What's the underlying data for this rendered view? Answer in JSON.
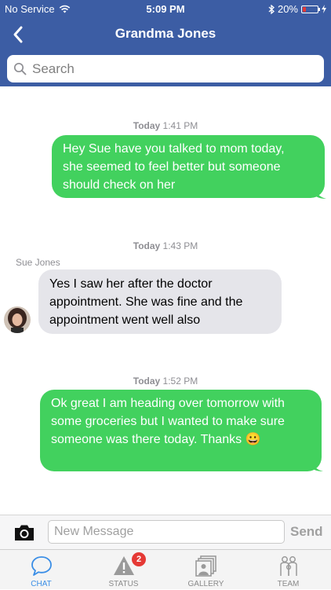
{
  "status_bar": {
    "carrier": "No Service",
    "time": "5:09 PM",
    "battery_percent": "20%",
    "battery_level": 0.2
  },
  "nav": {
    "title": "Grandma Jones"
  },
  "search": {
    "placeholder": "Search"
  },
  "messages": [
    {
      "day": "Today",
      "time": "1:41 PM",
      "direction": "outgoing",
      "lines": [
        "Hey Sue have you talked to mom today,",
        "she seemed to feel better but someone",
        "should check on her"
      ]
    },
    {
      "day": "Today",
      "time": "1:43 PM",
      "direction": "incoming",
      "sender": "Sue Jones",
      "lines": [
        "Yes I saw her after the doctor",
        "appointment.  She was fine and the",
        "appointment went well also"
      ]
    },
    {
      "day": "Today",
      "time": "1:52 PM",
      "direction": "outgoing",
      "lines": [
        "Ok great I am heading over tomorrow with",
        "some groceries but I wanted to make sure",
        "someone was there today.  Thanks 😀"
      ]
    }
  ],
  "composer": {
    "placeholder": "New Message",
    "send_label": "Send"
  },
  "tabs": [
    {
      "label": "CHAT",
      "active": true
    },
    {
      "label": "STATUS",
      "badge": "2"
    },
    {
      "label": "GALLERY"
    },
    {
      "label": "TEAM"
    }
  ],
  "colors": {
    "nav": "#3c5da4",
    "outgoing_bubble": "#42d15e",
    "incoming_bubble": "#e5e5ea",
    "active_tab": "#3a8ee6",
    "badge": "#e53935"
  }
}
